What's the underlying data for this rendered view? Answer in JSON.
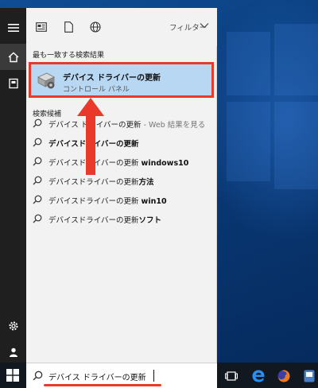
{
  "filter": {
    "label": "フィルター"
  },
  "best_match": {
    "header": "最も一致する検索結果",
    "title": "デバイス ドライバーの更新",
    "subtitle": "コントロール パネル"
  },
  "suggestions": {
    "header": "検索候補",
    "items": [
      {
        "base": "デバイス ドライバーの更新",
        "bold": "",
        "hint": " - Web 結果を見る"
      },
      {
        "base": "",
        "bold": "デバイスドライバーの更新",
        "hint": ""
      },
      {
        "base": "デバイスドライバーの更新 ",
        "bold": "windows10",
        "hint": ""
      },
      {
        "base": "デバイスドライバーの更新",
        "bold": "方法",
        "hint": ""
      },
      {
        "base": "デバイスドライバーの更新 ",
        "bold": "win10",
        "hint": ""
      },
      {
        "base": "デバイスドライバーの更新",
        "bold": "ソフト",
        "hint": ""
      }
    ]
  },
  "search": {
    "value": "デバイス ドライバーの更新"
  },
  "colors": {
    "accent": "#e8392b",
    "highlight": "#b8d7f2",
    "rail": "#1f1f1f"
  },
  "icons": [
    "hamburger-icon",
    "home-icon",
    "document-icon",
    "globe-icon",
    "chevron-down-icon",
    "device-driver-icon",
    "search-icon",
    "settings-icon",
    "user-icon",
    "windows-logo",
    "task-view-icon",
    "edge-icon",
    "firefox-icon"
  ]
}
